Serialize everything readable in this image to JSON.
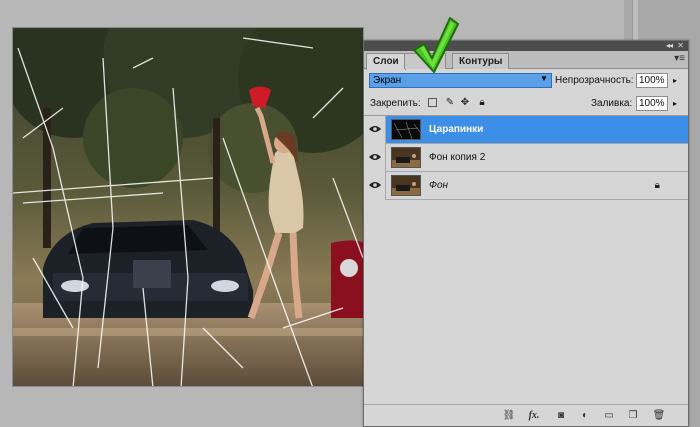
{
  "panel": {
    "tabs": [
      {
        "label": "Слои",
        "active": true
      },
      {
        "label": "",
        "active": false
      },
      {
        "label": "Контуры",
        "active": false
      }
    ],
    "collapse_glyph": "◂◂",
    "close_glyph": "✕",
    "menu_glyph": "▾≡",
    "blend_mode": "Экран",
    "opacity_label": "Непрозрачность:",
    "opacity_value": "100%",
    "lock_label": "Закрепить:",
    "fill_label": "Заливка:",
    "fill_value": "100%",
    "layers": [
      {
        "name": "Царапинки",
        "selected": true,
        "visible": true,
        "locked": false,
        "italic": false
      },
      {
        "name": "Фон копия 2",
        "selected": false,
        "visible": true,
        "locked": false,
        "italic": false
      },
      {
        "name": "Фон",
        "selected": false,
        "visible": true,
        "locked": true,
        "italic": true
      }
    ],
    "bottom_icons": [
      "link-icon",
      "fx-icon",
      "mask-icon",
      "adjustment-icon",
      "folder-icon",
      "new-layer-icon",
      "trash-icon"
    ],
    "bottom_labels": {
      "fx": "fx."
    }
  },
  "colors": {
    "selection": "#3d8ee6",
    "blend_field": "#5aa0e8",
    "checkmark": "#44c81e",
    "panel_bg": "#d6d6d6"
  }
}
